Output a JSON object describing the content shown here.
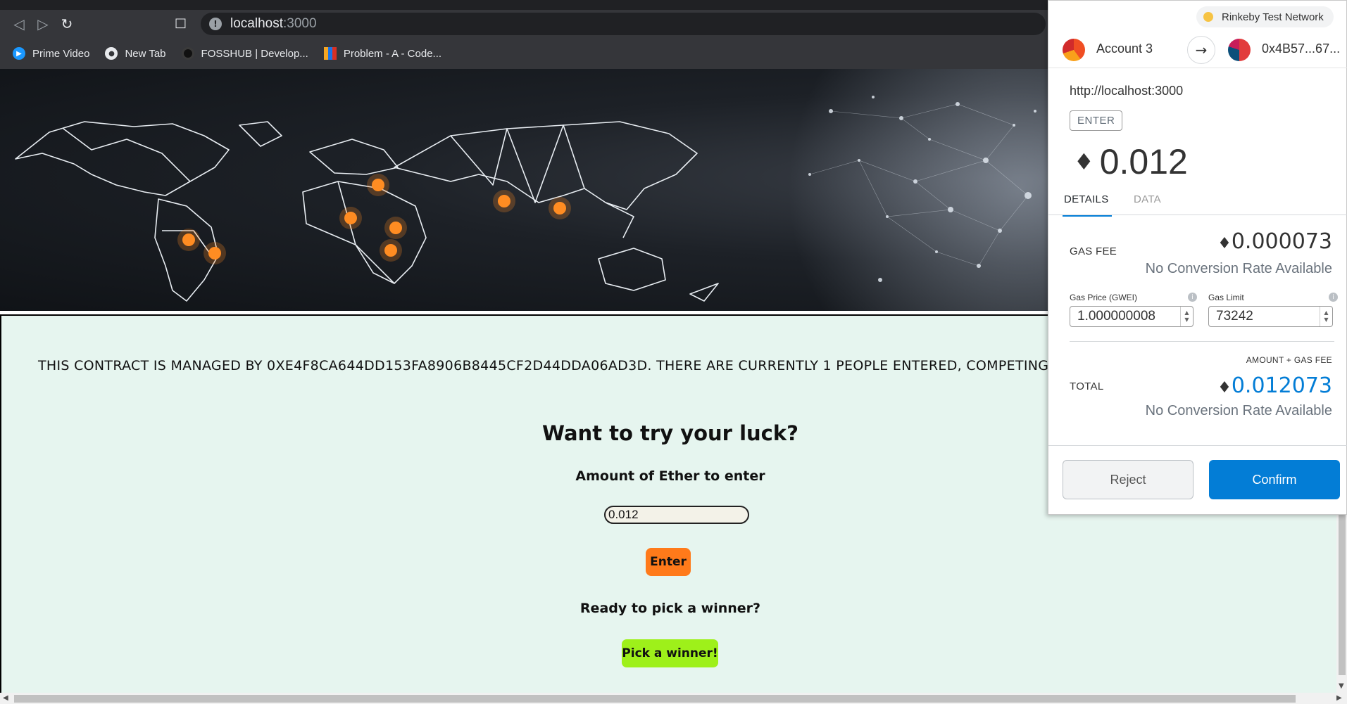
{
  "browser": {
    "url_host": "localhost",
    "url_port": ":3000",
    "bookmarks": [
      {
        "label": "Prime Video",
        "color": "#1a98ff"
      },
      {
        "label": "New Tab",
        "color": "#e8eaed"
      },
      {
        "label": "FOSSHUB | Develop...",
        "color": "#1a1a1a"
      },
      {
        "label": "Problem - A - Code...",
        "color": "#f5a623"
      }
    ]
  },
  "page": {
    "banner_text": "THIS CONTRACT IS MANAGED BY 0XE4F8CA644DD153FA8906B8445CF2D44DDA06AD3D. THERE ARE CURRENTLY 1 PEOPLE ENTERED, COMPETING TO",
    "heading": "Want to try your luck?",
    "amount_label": "Amount of Ether to enter",
    "amount_value": "0.012",
    "enter_label": "Enter",
    "pick_label": "Ready to pick a winner?",
    "pick_button": "Pick a winner!",
    "colors": {
      "background": "#e6f5ef",
      "enter": "#ff7a1a",
      "pick": "#9ef01a"
    }
  },
  "metamask": {
    "network": "Rinkeby Test Network",
    "account": "Account 3",
    "to_address": "0x4B57...67...",
    "origin": "http://localhost:3000",
    "method": "ENTER",
    "amount": "0.012",
    "tabs": [
      "DETAILS",
      "DATA"
    ],
    "gas_fee_label": "GAS FEE",
    "gas_fee_value": "0.000073",
    "no_conversion": "No Conversion Rate Available",
    "gas_price_label": "Gas Price (GWEI)",
    "gas_price_value": "1.000000008",
    "gas_limit_label": "Gas Limit",
    "gas_limit_value": "73242",
    "amount_gas_label": "AMOUNT + GAS FEE",
    "total_label": "TOTAL",
    "total_value": "0.012073",
    "reject_label": "Reject",
    "confirm_label": "Confirm",
    "accent_color": "#037dd6"
  }
}
